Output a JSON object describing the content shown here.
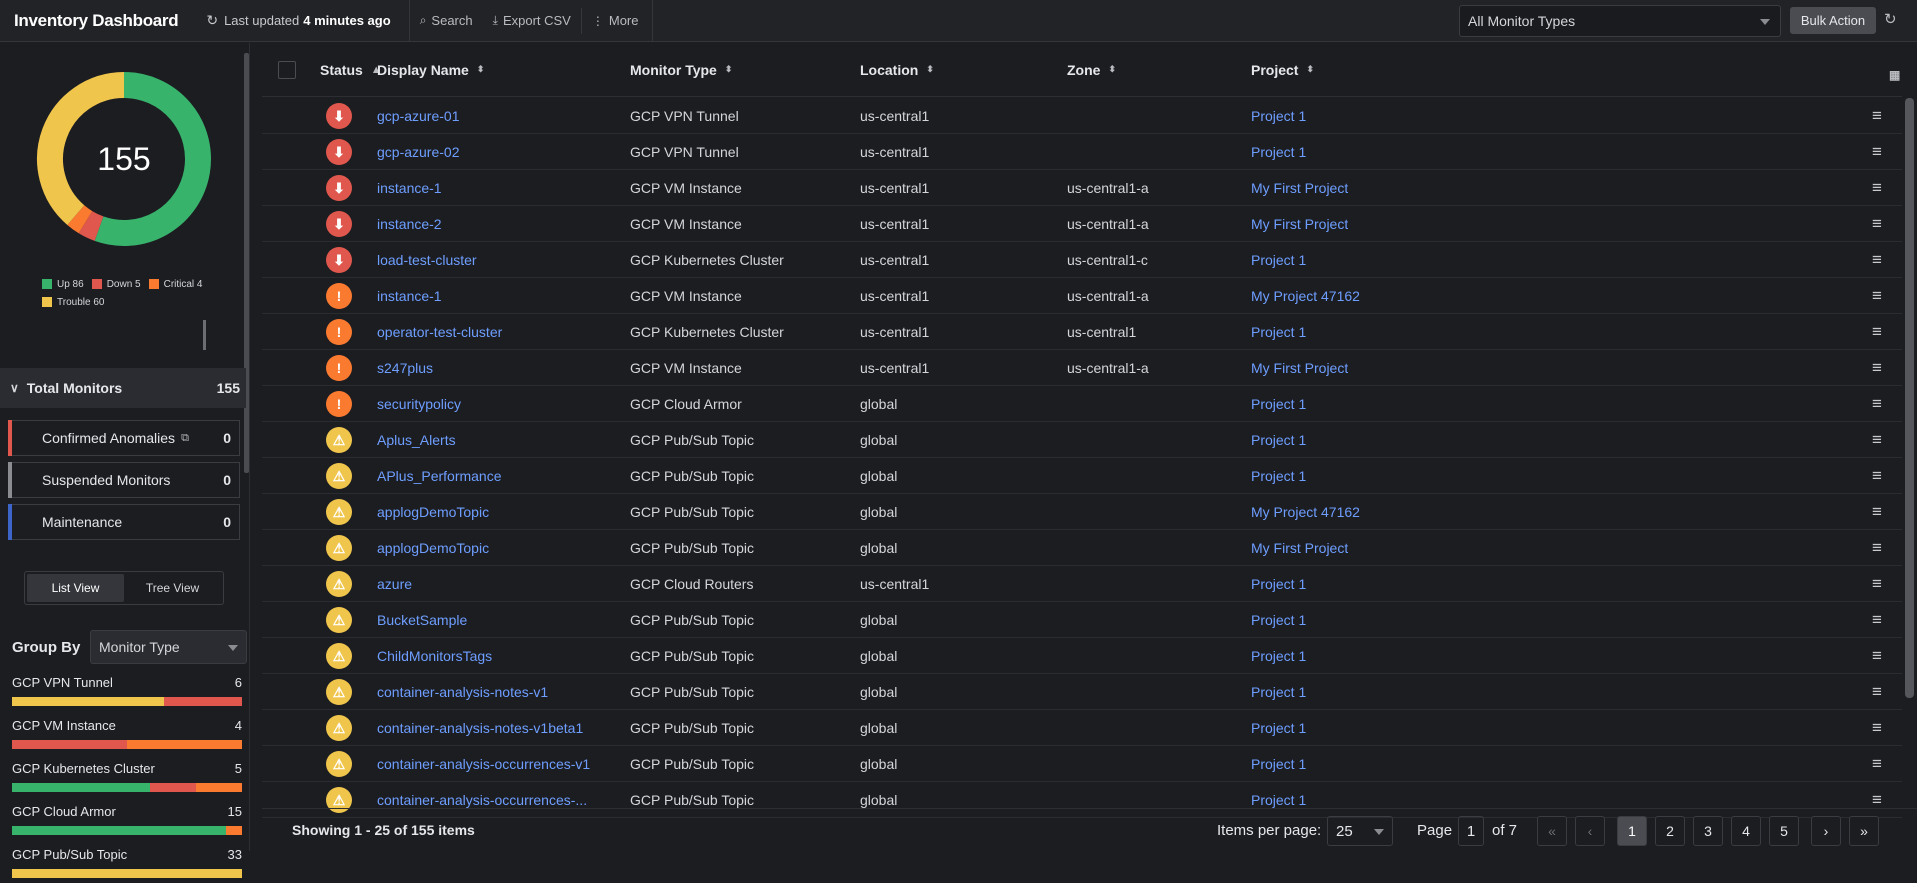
{
  "header": {
    "title": "Inventory Dashboard",
    "updated_prefix": "Last updated",
    "updated_value": "4 minutes ago",
    "search_label": "Search",
    "export_label": "Export CSV",
    "more_label": "More",
    "monitor_type_select": "All Monitor Types",
    "bulk_action_label": "Bulk Action"
  },
  "summary": {
    "total": "155",
    "up_count": 86,
    "down_count": 5,
    "critical_count": 4,
    "trouble_count": 60,
    "legend": {
      "up": "Up 86",
      "down": "Down 5",
      "critical": "Critical 4",
      "trouble": "Trouble 60"
    },
    "colors": {
      "up": "#37b36c",
      "down": "#e0574d",
      "critical": "#fa7a30",
      "trouble": "#f0c54c"
    }
  },
  "sidebar": {
    "total_label": "Total Monitors",
    "total_count": "155",
    "stats": [
      {
        "label": "Confirmed Anomalies",
        "count": "0",
        "accent": "#e0574d"
      },
      {
        "label": "Suspended Monitors",
        "count": "0",
        "accent": "#8a8c91"
      },
      {
        "label": "Maintenance",
        "count": "0",
        "accent": "#3d64c8"
      }
    ],
    "view_list": "List View",
    "view_tree": "Tree View",
    "group_by_label": "Group By",
    "group_by_value": "Monitor Type",
    "groups": [
      {
        "name": "GCP VPN Tunnel",
        "count": "6",
        "segments": [
          {
            "c": "#f0c54c",
            "v": 66
          },
          {
            "c": "#e0574d",
            "v": 34
          }
        ]
      },
      {
        "name": "GCP VM Instance",
        "count": "4",
        "segments": [
          {
            "c": "#e0574d",
            "v": 50
          },
          {
            "c": "#fa7a30",
            "v": 50
          }
        ]
      },
      {
        "name": "GCP Kubernetes Cluster",
        "count": "5",
        "segments": [
          {
            "c": "#37b36c",
            "v": 60
          },
          {
            "c": "#e0574d",
            "v": 20
          },
          {
            "c": "#fa7a30",
            "v": 20
          }
        ]
      },
      {
        "name": "GCP Cloud Armor",
        "count": "15",
        "segments": [
          {
            "c": "#37b36c",
            "v": 93
          },
          {
            "c": "#fa7a30",
            "v": 7
          }
        ]
      },
      {
        "name": "GCP Pub/Sub Topic",
        "count": "33",
        "segments": [
          {
            "c": "#f0c54c",
            "v": 100
          }
        ]
      }
    ]
  },
  "table": {
    "headers": {
      "status": "Status",
      "display_name": "Display Name",
      "monitor_type": "Monitor Type",
      "location": "Location",
      "zone": "Zone",
      "project": "Project"
    },
    "rows": [
      {
        "status": "down",
        "name": "gcp-azure-01",
        "type": "GCP VPN Tunnel",
        "location": "us-central1",
        "zone": "",
        "project": "Project 1"
      },
      {
        "status": "down",
        "name": "gcp-azure-02",
        "type": "GCP VPN Tunnel",
        "location": "us-central1",
        "zone": "",
        "project": "Project 1"
      },
      {
        "status": "down",
        "name": "instance-1",
        "type": "GCP VM Instance",
        "location": "us-central1",
        "zone": "us-central1-a",
        "project": "My First Project"
      },
      {
        "status": "down",
        "name": "instance-2",
        "type": "GCP VM Instance",
        "location": "us-central1",
        "zone": "us-central1-a",
        "project": "My First Project"
      },
      {
        "status": "down",
        "name": "load-test-cluster",
        "type": "GCP Kubernetes Cluster",
        "location": "us-central1",
        "zone": "us-central1-c",
        "project": "Project 1"
      },
      {
        "status": "critical",
        "name": "instance-1",
        "type": "GCP VM Instance",
        "location": "us-central1",
        "zone": "us-central1-a",
        "project": "My Project 47162"
      },
      {
        "status": "critical",
        "name": "operator-test-cluster",
        "type": "GCP Kubernetes Cluster",
        "location": "us-central1",
        "zone": "us-central1",
        "project": "Project 1"
      },
      {
        "status": "critical",
        "name": "s247plus",
        "type": "GCP VM Instance",
        "location": "us-central1",
        "zone": "us-central1-a",
        "project": "My First Project"
      },
      {
        "status": "critical",
        "name": "securitypolicy",
        "type": "GCP Cloud Armor",
        "location": "global",
        "zone": "",
        "project": "Project 1"
      },
      {
        "status": "trouble",
        "name": "Aplus_Alerts",
        "type": "GCP Pub/Sub Topic",
        "location": "global",
        "zone": "",
        "project": "Project 1"
      },
      {
        "status": "trouble",
        "name": "APlus_Performance",
        "type": "GCP Pub/Sub Topic",
        "location": "global",
        "zone": "",
        "project": "Project 1"
      },
      {
        "status": "trouble",
        "name": "applogDemoTopic",
        "type": "GCP Pub/Sub Topic",
        "location": "global",
        "zone": "",
        "project": "My Project 47162"
      },
      {
        "status": "trouble",
        "name": "applogDemoTopic",
        "type": "GCP Pub/Sub Topic",
        "location": "global",
        "zone": "",
        "project": "My First Project"
      },
      {
        "status": "trouble",
        "name": "azure",
        "type": "GCP Cloud Routers",
        "location": "us-central1",
        "zone": "",
        "project": "Project 1"
      },
      {
        "status": "trouble",
        "name": "BucketSample",
        "type": "GCP Pub/Sub Topic",
        "location": "global",
        "zone": "",
        "project": "Project 1"
      },
      {
        "status": "trouble",
        "name": "ChildMonitorsTags",
        "type": "GCP Pub/Sub Topic",
        "location": "global",
        "zone": "",
        "project": "Project 1"
      },
      {
        "status": "trouble",
        "name": "container-analysis-notes-v1",
        "type": "GCP Pub/Sub Topic",
        "location": "global",
        "zone": "",
        "project": "Project 1"
      },
      {
        "status": "trouble",
        "name": "container-analysis-notes-v1beta1",
        "type": "GCP Pub/Sub Topic",
        "location": "global",
        "zone": "",
        "project": "Project 1"
      },
      {
        "status": "trouble",
        "name": "container-analysis-occurrences-v1",
        "type": "GCP Pub/Sub Topic",
        "location": "global",
        "zone": "",
        "project": "Project 1"
      },
      {
        "status": "trouble",
        "name": "container-analysis-occurrences-...",
        "type": "GCP Pub/Sub Topic",
        "location": "global",
        "zone": "",
        "project": "Project 1"
      }
    ]
  },
  "footer": {
    "showing": "Showing 1 - 25 of 155 items",
    "items_per_page_label": "Items per page:",
    "items_per_page": "25",
    "page_label": "Page",
    "page_value": "1",
    "page_of": "of 7",
    "pages": [
      "1",
      "2",
      "3",
      "4",
      "5"
    ],
    "current_page": "1"
  }
}
